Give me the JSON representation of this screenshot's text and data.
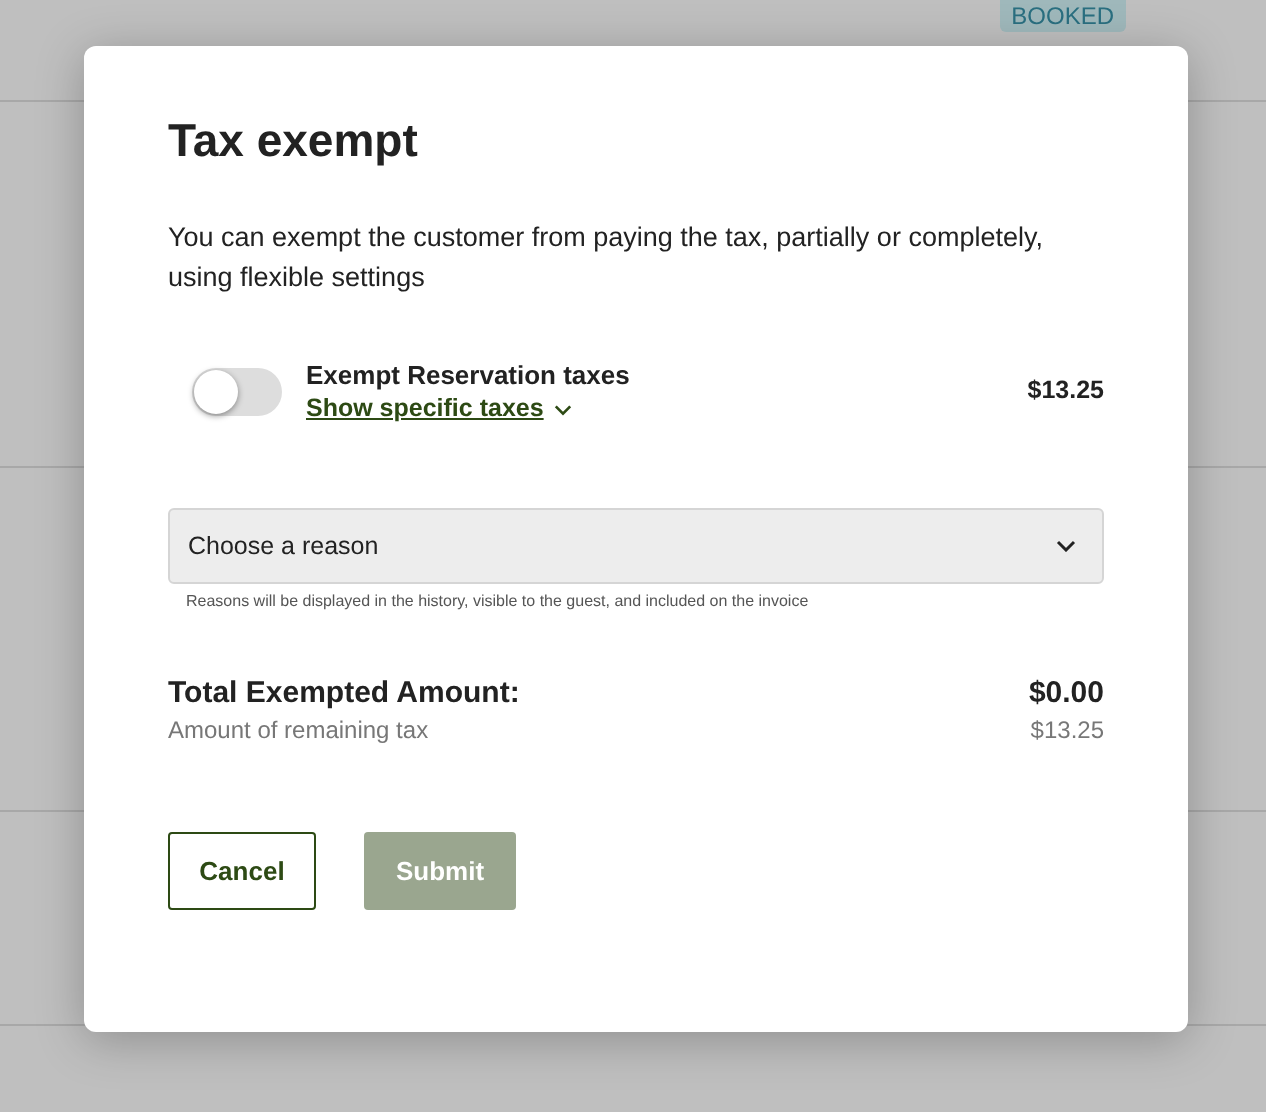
{
  "background": {
    "badge": "BOOKED"
  },
  "dialog": {
    "title": "Tax exempt",
    "description": "You can exempt the customer from paying the tax, partially or completely, using flexible settings",
    "exemption": {
      "label": "Exempt Reservation taxes",
      "on": false,
      "link": "Show specific taxes",
      "amount": "$13.25"
    },
    "reason": {
      "placeholder": "Choose a reason",
      "hint": "Reasons will be displayed in the history, visible to the guest, and included on the invoice"
    },
    "total": {
      "label": "Total Exempted Amount:",
      "value": "$0.00"
    },
    "remaining": {
      "label": "Amount of remaining tax",
      "value": "$13.25"
    },
    "buttons": [
      {
        "label": "Cancel",
        "kind": "secondary",
        "disabled": false
      },
      {
        "label": "Submit",
        "kind": "primary",
        "disabled": true
      }
    ]
  }
}
